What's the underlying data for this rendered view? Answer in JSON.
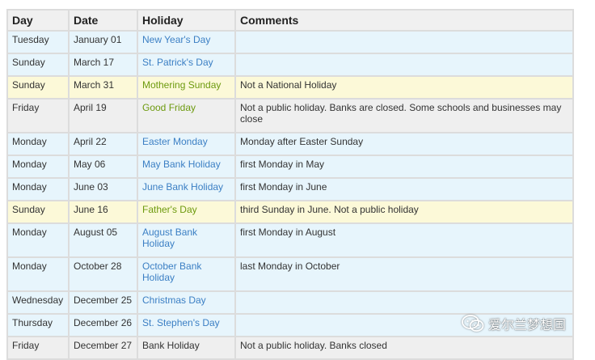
{
  "table": {
    "headers": [
      "Day",
      "Date",
      "Holiday",
      "Comments"
    ],
    "rows": [
      {
        "day": "Tuesday",
        "date": "January 01",
        "holiday": "New Year's Day",
        "comments": "",
        "type": "national"
      },
      {
        "day": "Sunday",
        "date": "March 17",
        "holiday": "St. Patrick's Day",
        "comments": "",
        "type": "national"
      },
      {
        "day": "Sunday",
        "date": "March 31",
        "holiday": "Mothering Sunday",
        "comments": "Not a National Holiday",
        "type": "observance"
      },
      {
        "day": "Friday",
        "date": "April 19",
        "holiday": "Good Friday",
        "comments": "Not a public holiday. Banks are closed. Some schools and businesses may close",
        "type": "bank-observance"
      },
      {
        "day": "Monday",
        "date": "April 22",
        "holiday": "Easter Monday",
        "comments": "Monday after Easter Sunday",
        "type": "national"
      },
      {
        "day": "Monday",
        "date": "May 06",
        "holiday": "May Bank Holiday",
        "comments": "first Monday in May",
        "type": "national"
      },
      {
        "day": "Monday",
        "date": "June 03",
        "holiday": "June Bank Holiday",
        "comments": "first Monday in June",
        "type": "national"
      },
      {
        "day": "Sunday",
        "date": "June 16",
        "holiday": "Father's Day",
        "comments": "third Sunday in June. Not a public holiday",
        "type": "observance"
      },
      {
        "day": "Monday",
        "date": "August 05",
        "holiday": "August Bank Holiday",
        "comments": "first Monday in August",
        "type": "national"
      },
      {
        "day": "Monday",
        "date": "October 28",
        "holiday": "October Bank Holiday",
        "comments": "last Monday in October",
        "type": "national"
      },
      {
        "day": "Wednesday",
        "date": "December 25",
        "holiday": "Christmas Day",
        "comments": "",
        "type": "national"
      },
      {
        "day": "Thursday",
        "date": "December 26",
        "holiday": "St. Stephen's Day",
        "comments": "",
        "type": "national"
      },
      {
        "day": "Friday",
        "date": "December 27",
        "holiday": "Bank Holiday",
        "comments": "Not a public holiday. Banks closed",
        "type": "bank"
      }
    ]
  },
  "colors": {
    "national_bg": "#e7f5fc",
    "observance_bg": "#fcf9d8",
    "bank_bg": "#efefef",
    "national_text": "#3b7fc4",
    "observance_text": "#6d9a0e"
  },
  "watermark": {
    "icon": "wechat-icon",
    "text": "爱尔兰梦想国"
  }
}
